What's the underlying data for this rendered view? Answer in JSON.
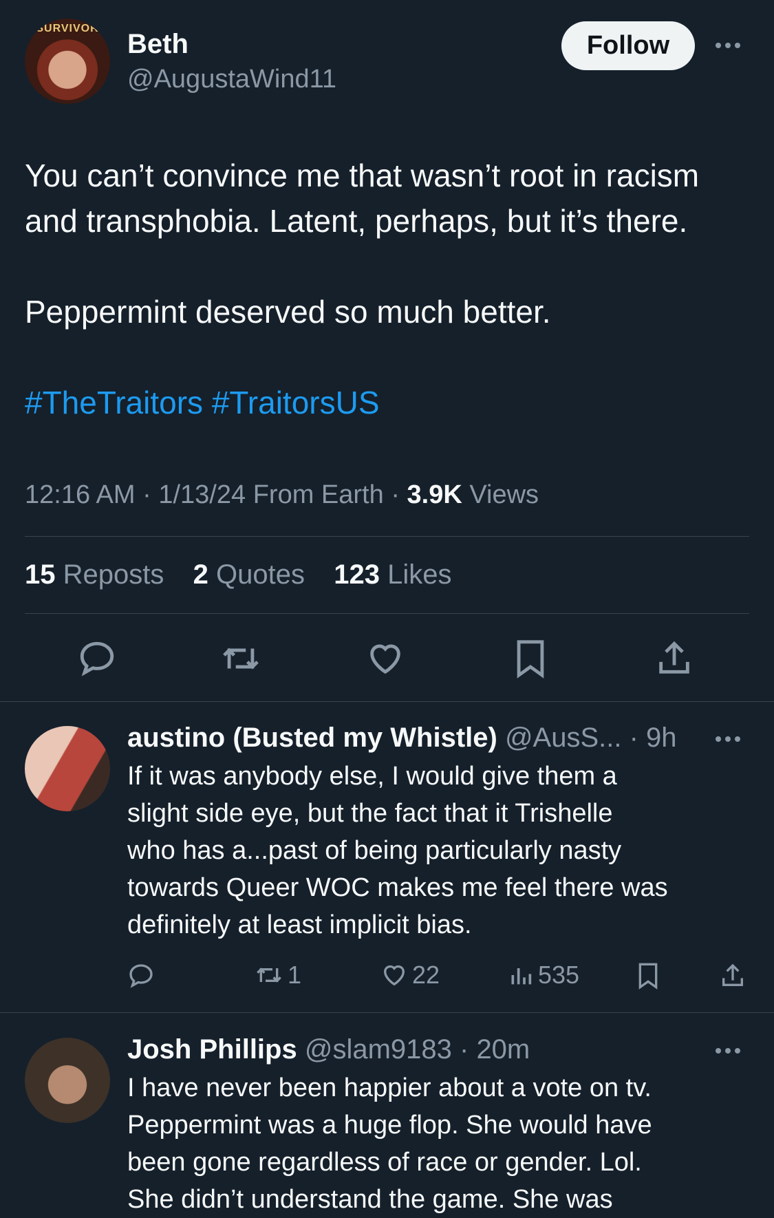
{
  "main_tweet": {
    "author_name": "Beth",
    "author_handle": "@AugustaWind11",
    "avatar_text": "SURVIVOR",
    "follow_label": "Follow",
    "text_line1": "You can’t convince me that wasn’t root in racism",
    "text_line2": "and transphobia. Latent, perhaps, but it’s there.",
    "text_line3": "Peppermint deserved so much better.",
    "hashtags": "#TheTraitors #TraitorsUS",
    "time": "12:16 AM",
    "date": "1/13/24",
    "source": "From Earth",
    "views_count": "3.9K",
    "views_label": "Views",
    "reposts_count": "15",
    "reposts_label": "Reposts",
    "quotes_count": "2",
    "quotes_label": "Quotes",
    "likes_count": "123",
    "likes_label": "Likes"
  },
  "replies": [
    {
      "name": "austino (Busted my Whistle)",
      "handle": "@AusS...",
      "time": "9h",
      "lines": [
        "If it was anybody else, I would give them a",
        "slight side eye, but the fact that it Trishelle",
        "who has a...past of being particularly nasty",
        "towards Queer WOC makes me feel there was",
        "definitely at least implicit bias."
      ],
      "reposts": "1",
      "likes": "22",
      "views": "535"
    },
    {
      "name": "Josh Phillips",
      "handle": "@slam9183",
      "time": "20m",
      "lines": [
        "I have never been happier about a vote on tv.",
        "Peppermint was a huge flop. She would have",
        "been gone regardless of race or gender. Lol.",
        "She didn’t understand the game. She was"
      ]
    }
  ],
  "colors": {
    "background": "#15202b",
    "link": "#1d9bf0",
    "muted": "#8b98a5",
    "divider": "#38444d"
  }
}
